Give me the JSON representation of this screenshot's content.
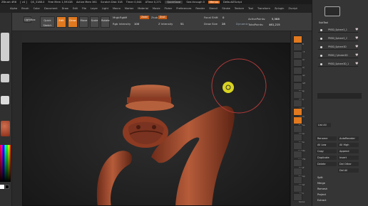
{
  "title_bar": {
    "app_title": "ZBrush 4R6",
    "doc_info": "[ v4 ]",
    "version": "QS_3188.0",
    "free_mem": "Free Mem 1,591GB",
    "active_mem": "Active Mem 361",
    "scratch": "Scratch Disk 318",
    "timer": "Timer 0,044",
    "atime": "ATime 0,271",
    "quicksave": "QuickSave",
    "see_through": "See-through 0",
    "menus": "Menus",
    "default_script": "DefaultZScript"
  },
  "menu_bar": [
    "Alpha",
    "Brush",
    "Color",
    "Document",
    "Draw",
    "Edit",
    "File",
    "Layer",
    "Light",
    "Macro",
    "Marker",
    "Material",
    "Movie",
    "Picker",
    "Preferences",
    "Render",
    "Stencil",
    "Stroke",
    "Texture",
    "Tool",
    "Transform",
    "Zplugin",
    "Zscript"
  ],
  "shelf": {
    "lightbox": "LightBox",
    "quick_sketch": "Quick Sketch",
    "edit": "Edit",
    "draw": "Draw",
    "move": "Move",
    "scale": "Scale",
    "rotate": "Rotate",
    "mrgb": "Mrgb",
    "rgb": "Rgb",
    "m": "M",
    "zadd": "Zadd",
    "zsub": "Zsub",
    "zcut": "Zcut",
    "rgb_intensity_label": "Rgb Intensity",
    "rgb_intensity_value": "100",
    "focal_shift_label": "Focal Shift",
    "focal_shift_value": "0",
    "draw_size_label": "Draw Size",
    "draw_size_value": "28",
    "dynamic": "Dynamic",
    "z_intensity_label": "Z Intensity",
    "z_intensity_value": "51",
    "active_points_label": "ActivePoints:",
    "active_points_value": "5,588",
    "total_points_label": "TotalPoints:",
    "total_points_value": "461,215"
  },
  "right_tray": [
    "BPR",
    "SPix 3",
    "Scroll",
    "Zoom",
    "Actual",
    "AAHalf",
    "Persp",
    "Floor",
    "Local",
    "LSym",
    "Frame",
    "Move",
    "Scale",
    "Rotate",
    "Line Fill",
    "PolyF",
    "Transp",
    "Ghost",
    "Solo",
    "Xpose"
  ],
  "subtool_panel": {
    "header": "SubTool",
    "items": [
      "PM3D_Sphere3_1",
      "PM3D_Sphere3_2",
      "PM3D_Sphere3D",
      "PM3D_Cylinder3D",
      "PM3D_Sphere3D_1"
    ],
    "list_all": "List All",
    "buttons": [
      [
        "Rename",
        "AutoReorder"
      ],
      [
        "All Low",
        "All High"
      ],
      [
        "Copy",
        "Append"
      ],
      [
        "Duplicate",
        "Insert"
      ],
      [
        "Delete",
        "Del Other"
      ],
      [
        "",
        "Del All"
      ]
    ],
    "extra": [
      "Split",
      "Merge",
      "Remesh",
      "Project",
      "Extract"
    ]
  },
  "colors": {
    "accent": "#e0791f",
    "model": "#a85032",
    "brush_ring": "#b83a3a",
    "cursor": "#d8d320"
  }
}
